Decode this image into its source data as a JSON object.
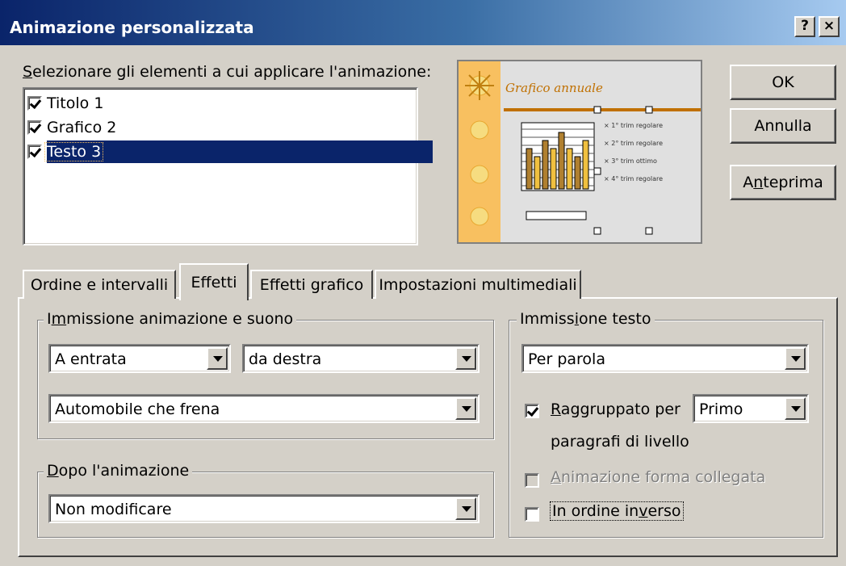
{
  "window": {
    "title": "Animazione personalizzata",
    "help_label": "?",
    "close_label": "×"
  },
  "elements_list": {
    "label": "Selezionare gli elementi a cui applicare l'animazione:",
    "items": [
      {
        "label": "Titolo 1",
        "checked": true,
        "selected": false
      },
      {
        "label": "Grafico 2",
        "checked": true,
        "selected": false
      },
      {
        "label": "Testo 3",
        "checked": true,
        "selected": true
      }
    ]
  },
  "preview": {
    "slide_title": "Grafico annuale",
    "bullets": [
      "1° trim regolare",
      "2° trim regolare",
      "3° trim ottimo",
      "4° trim regolare"
    ],
    "bar_values": [
      5,
      4,
      6,
      5,
      7,
      5,
      4,
      6
    ],
    "accent_color": "#f8c060"
  },
  "buttons": {
    "ok": "OK",
    "cancel": "Annulla",
    "preview": "Anteprima"
  },
  "tabs": [
    {
      "label": "Ordine e intervalli",
      "active": false
    },
    {
      "label": "Effetti",
      "active": true
    },
    {
      "label": "Effetti grafico",
      "active": false
    },
    {
      "label": "Impostazioni multimediali",
      "active": false
    }
  ],
  "entry_group": {
    "label": "Immissione animazione e suono",
    "effect": "A entrata",
    "direction": "da destra",
    "sound": "Automobile che frena"
  },
  "after_group": {
    "label": "Dopo l'animazione",
    "value": "Non modificare"
  },
  "text_group": {
    "label": "Immissione testo",
    "mode": "Per parola",
    "grouped_label": "Raggruppato per",
    "grouped_checked": true,
    "level_value": "Primo",
    "level_suffix": "paragrafi di livello",
    "attached_shape_label": "Animazione forma collegata",
    "attached_shape_enabled": false,
    "reverse_label": "In ordine inverso",
    "reverse_checked": false
  }
}
